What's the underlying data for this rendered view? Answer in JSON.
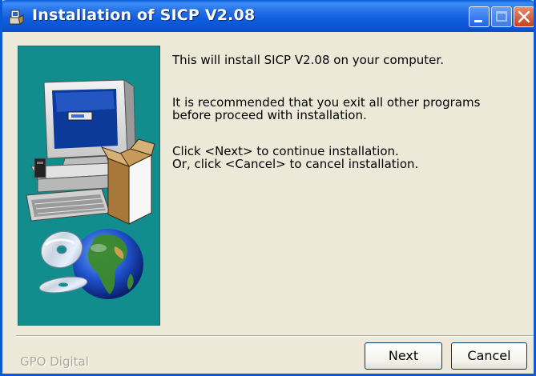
{
  "window": {
    "title": "Installation of SICP V2.08"
  },
  "content": {
    "line1": "This will install SICP V2.08 on your computer.",
    "line2a": "It is recommended that you exit all other programs",
    "line2b": "before proceed with installation.",
    "line3a": "Click <Next> to continue installation.",
    "line3b": "Or, click <Cancel> to cancel installation."
  },
  "footer": {
    "brand": "GPO Digital",
    "next_label": "Next",
    "cancel_label": "Cancel"
  },
  "colors": {
    "titlebar": "#0a5ad6",
    "panel": "#128d8d",
    "dialog_bg": "#ece9d8"
  }
}
